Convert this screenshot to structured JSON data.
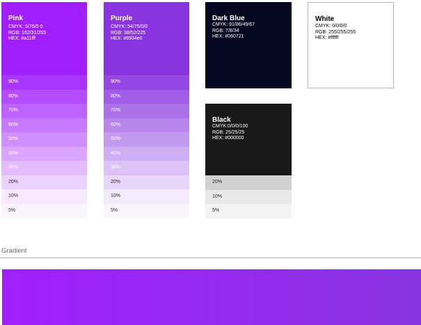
{
  "cards": {
    "pink": {
      "name": "Pink",
      "cmyk": "CMYK: 5/76/0 0",
      "rgb": "RGB: 162/31/255",
      "hex": "HEX: #a11fff",
      "color": "#a11fff",
      "tints": [
        "90%",
        "80%",
        "70%",
        "60%",
        "50%",
        "40%",
        "30%",
        "20%",
        "10%",
        "5%"
      ]
    },
    "purple": {
      "name": "Purple",
      "cmyk": "CMYK: 54/75/0/0",
      "rgb": "RGB: 38/52/225",
      "hex": "HEX: #8934e0",
      "color": "#8934e0",
      "tints": [
        "90%",
        "80%",
        "70%",
        "60%",
        "50%",
        "40%",
        "30%",
        "20%",
        "10%",
        "5%"
      ]
    },
    "dark_blue": {
      "name": "Dark Blue",
      "cmyk": "CMYK: 91/86/49/67",
      "rgb": "RGB: 7/8/34",
      "hex": "HEX: #060721",
      "color": "#060721"
    },
    "white": {
      "name": "White",
      "cmyk": "CMYK: 0/0/0/0",
      "rgb": "RGB: 255/255/255",
      "hex": "HEX: #ffffff",
      "color": "#ffffff"
    },
    "black": {
      "name": "Black",
      "cmyk": "CMYK:0/0/0/100",
      "rgb": "RGB: 25/25/25",
      "hex": "HEX: #000000",
      "color": "#191919",
      "tints": [
        "20%",
        "10%",
        "5%"
      ]
    }
  },
  "gradient": {
    "label": "Gradient",
    "from": "#a11fff",
    "to": "#8934e0"
  }
}
